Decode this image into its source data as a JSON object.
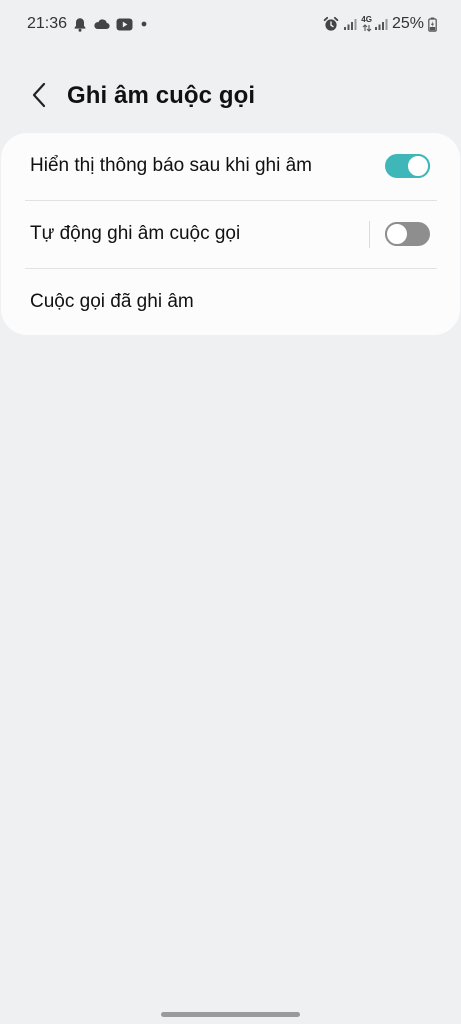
{
  "status_bar": {
    "time": "21:36",
    "network_type": "4G",
    "battery_percent": "25%",
    "icons": [
      "bell-icon",
      "cloud-icon",
      "youtube-icon",
      "dot-icon",
      "alarm-icon",
      "signal-icon",
      "signal-icon",
      "battery-charging-icon"
    ]
  },
  "header": {
    "title": "Ghi âm cuộc gọi",
    "back_icon": "chevron-left-icon"
  },
  "settings": {
    "items": [
      {
        "label": "Hiển thị thông báo sau khi ghi âm",
        "toggle": true
      },
      {
        "label": "Tự động ghi âm cuộc gọi",
        "toggle": false
      },
      {
        "label": "Cuộc gọi đã ghi âm"
      }
    ]
  },
  "colors": {
    "background": "#eef0f1",
    "card": "#fcfcfc",
    "toggle_on": "#3fb7b9",
    "toggle_off": "#8e8e8e"
  }
}
